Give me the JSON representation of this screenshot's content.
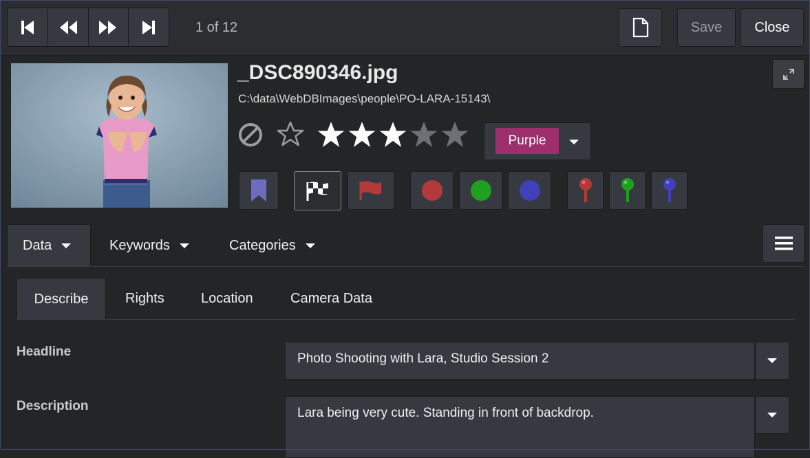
{
  "toolbar": {
    "counter": "1 of 12",
    "save_label": "Save",
    "close_label": "Close"
  },
  "file": {
    "name": "_DSC890346.jpg",
    "path": "C:\\data\\WebDBImages\\people\\PO-LARA-15143\\"
  },
  "rating": {
    "value": 3,
    "max": 5
  },
  "color_label": {
    "selected": "Purple",
    "color": "#9c2f6c"
  },
  "markers": {
    "bookmark_color": "#6c6cc0",
    "flag_color": "#b23a3a",
    "dots": [
      "#b23a3a",
      "#1fa01f",
      "#4040b8"
    ],
    "pins": [
      "#b23a3a",
      "#1fa01f",
      "#4040b8"
    ]
  },
  "main_tabs": [
    {
      "label": "Data"
    },
    {
      "label": "Keywords"
    },
    {
      "label": "Categories"
    }
  ],
  "sub_tabs": [
    {
      "label": "Describe"
    },
    {
      "label": "Rights"
    },
    {
      "label": "Location"
    },
    {
      "label": "Camera Data"
    }
  ],
  "fields": {
    "headline": {
      "label": "Headline",
      "value": "Photo Shooting with Lara, Studio Session 2"
    },
    "description": {
      "label": "Description",
      "value": "Lara being very cute. Standing in front of backdrop."
    }
  }
}
